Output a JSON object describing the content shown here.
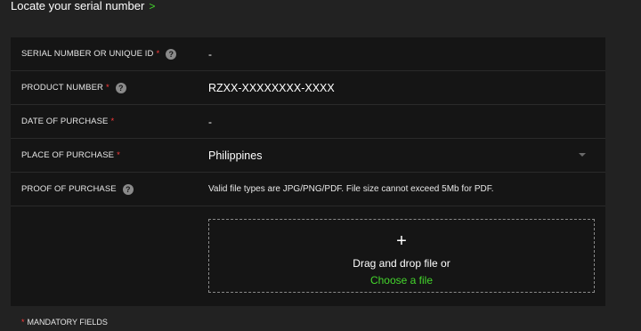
{
  "header": {
    "locate_link": "Locate your serial number",
    "chevron": ">"
  },
  "form": {
    "rows": [
      {
        "label": "SERIAL NUMBER OR UNIQUE ID",
        "required": "*",
        "help": "?",
        "value": "-"
      },
      {
        "label": "PRODUCT NUMBER",
        "required": "*",
        "help": "?",
        "value": "RZXX-XXXXXXXX-XXXX"
      },
      {
        "label": "DATE OF PURCHASE",
        "required": "*",
        "value": "-"
      },
      {
        "label": "PLACE OF PURCHASE",
        "required": "*",
        "value": "Philippines"
      },
      {
        "label": "PROOF OF PURCHASE",
        "help": "?",
        "value": "Valid file types are JPG/PNG/PDF. File size cannot exceed 5Mb for PDF."
      }
    ],
    "upload": {
      "plus": "+",
      "drag_text": "Drag and drop file or",
      "choose_link": "Choose a file"
    }
  },
  "footer": {
    "required_mark": "*",
    "mandatory_text": "MANDATORY FIELDS"
  },
  "colors": {
    "accent": "#44d62c",
    "required": "#ff3b3b",
    "panel": "#151515",
    "background": "#222222"
  }
}
